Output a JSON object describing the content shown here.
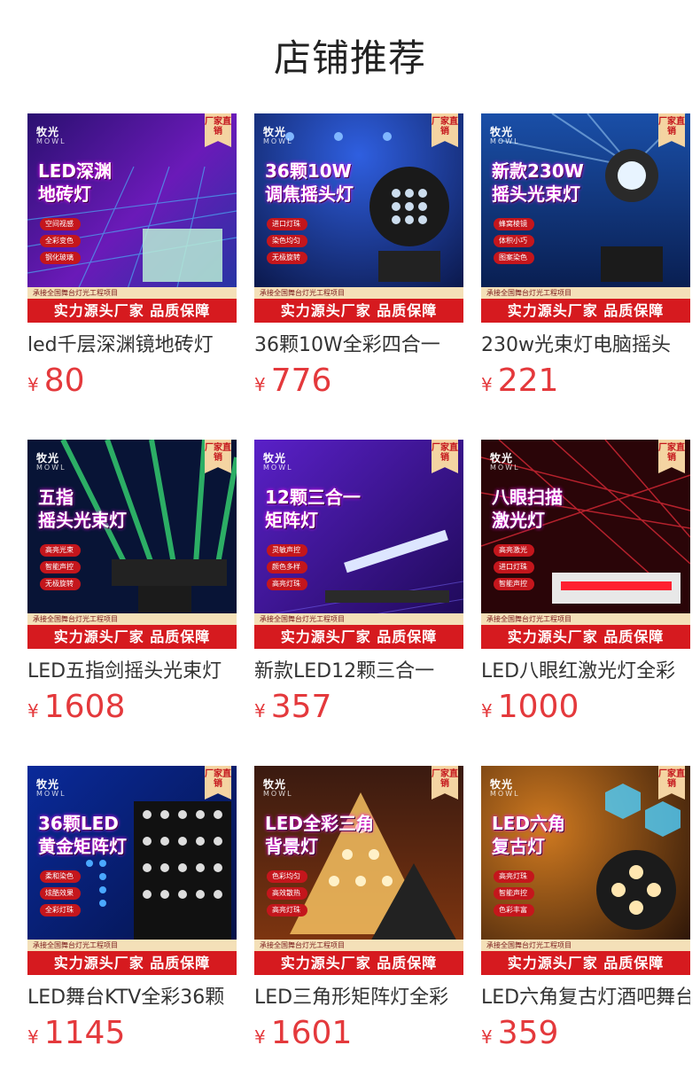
{
  "page_title": "店铺推荐",
  "banner_text": "实力源头厂家 品质保障",
  "strip_text": "承接全国舞台灯光工程项目",
  "badge_text": "厂家直销",
  "brand": {
    "cn": "牧光",
    "en": "MOWL"
  },
  "products": [
    {
      "name": "led千层深渊镜地砖灯",
      "currency": "¥",
      "price": "80",
      "head": "LED深渊\n地砖灯",
      "features": [
        "空间视感",
        "全彩变色",
        "钢化玻璃"
      ]
    },
    {
      "name": "36颗10W全彩四合一",
      "currency": "¥",
      "price": "776",
      "head": "36颗10W\n调焦摇头灯",
      "features": [
        "进口灯珠",
        "染色均匀",
        "无极旋转"
      ]
    },
    {
      "name": "230w光束灯电脑摇头",
      "currency": "¥",
      "price": "221",
      "head": "新款230W\n摇头光束灯",
      "features": [
        "蜂窝棱镜",
        "体积小巧",
        "图案染色"
      ]
    },
    {
      "name": "LED五指剑摇头光束灯",
      "currency": "¥",
      "price": "1608",
      "head": "五指\n摇头光束灯",
      "features": [
        "高亮光束",
        "智能声控",
        "无极旋转"
      ]
    },
    {
      "name": "新款LED12颗三合一",
      "currency": "¥",
      "price": "357",
      "head": "12颗三合一\n矩阵灯",
      "features": [
        "灵敏声控",
        "颜色多样",
        "高亮灯珠"
      ]
    },
    {
      "name": "LED八眼红激光灯全彩",
      "currency": "¥",
      "price": "1000",
      "head": "八眼扫描\n激光灯",
      "features": [
        "高亮激光",
        "进口灯珠",
        "智能声控"
      ]
    },
    {
      "name": "LED舞台KTV全彩36颗",
      "currency": "¥",
      "price": "1145",
      "head": "36颗LED\n黄金矩阵灯",
      "features": [
        "柔和染色",
        "炫酷效果",
        "全彩灯珠"
      ]
    },
    {
      "name": "LED三角形矩阵灯全彩",
      "currency": "¥",
      "price": "1601",
      "head": "LED全彩三角\n背景灯",
      "features": [
        "色彩均匀",
        "高效散热",
        "高亮灯珠"
      ]
    },
    {
      "name": "LED六角复古灯酒吧舞台",
      "currency": "¥",
      "price": "359",
      "head": "LED六角\n复古灯",
      "features": [
        "高亮灯珠",
        "智能声控",
        "色彩丰富"
      ]
    }
  ],
  "colors": {
    "price": "#e4393c",
    "banner": "#d61a1f",
    "badge": "#f4d4a2"
  }
}
